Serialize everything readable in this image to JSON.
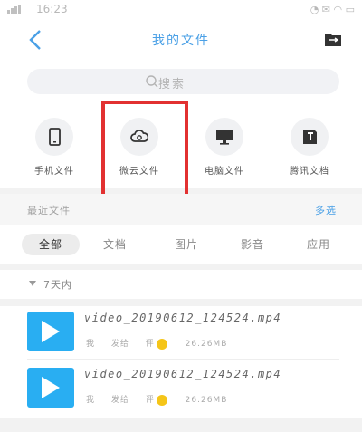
{
  "status": {
    "time": "16:23"
  },
  "header": {
    "title": "我的文件"
  },
  "search": {
    "placeholder": "搜索"
  },
  "categories": [
    {
      "label": "手机文件",
      "icon": "phone-icon"
    },
    {
      "label": "微云文件",
      "icon": "cloud-icon"
    },
    {
      "label": "电脑文件",
      "icon": "computer-icon"
    },
    {
      "label": "腾讯文档",
      "icon": "tencent-docs-icon"
    }
  ],
  "recent": {
    "title": "最近文件",
    "more": "多选"
  },
  "filters": [
    "全部",
    "文档",
    "图片",
    "影音",
    "应用"
  ],
  "group": {
    "label": "7天内"
  },
  "files": [
    {
      "name": "video_20190612_124524.mp4",
      "author": "我",
      "app": "发给",
      "tag": "评",
      "size": "26.26MB"
    },
    {
      "name": "video_20190612_124524.mp4",
      "author": "我",
      "app": "发给",
      "tag": "评",
      "size": "26.26MB"
    }
  ],
  "colors": {
    "accent": "#4aa0e6",
    "video": "#29aef2",
    "highlight": "#e23131"
  }
}
